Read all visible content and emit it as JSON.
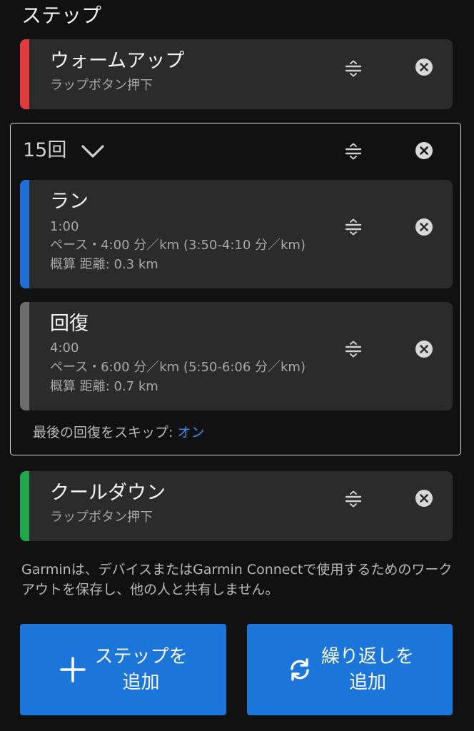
{
  "section_title": "ステップ",
  "colors": {
    "warmup_stripe": "#e03a3a",
    "run_stripe": "#1f6fd6",
    "recovery_stripe": "#6d6d6d",
    "cooldown_stripe": "#1fa54a",
    "accent_link": "#3f8ef0",
    "button_bg": "#1c75d8"
  },
  "warmup": {
    "title": "ウォームアップ",
    "subtitle": "ラップボタン押下",
    "drag_icon": "reorder-icon",
    "remove_icon": "close-circle-icon"
  },
  "repeat": {
    "count_label": "15回",
    "expand_icon": "chevron-down-icon",
    "run": {
      "title": "ラン",
      "duration": "1:00",
      "pace": "ペース・4:00 分／km (3:50-4:10 分／km)",
      "distance": "概算 距離: 0.3 km"
    },
    "recovery": {
      "title": "回復",
      "duration": "4:00",
      "pace": "ペース・6:00 分／km (5:50-6:06 分／km)",
      "distance": "概算 距離: 0.7 km"
    },
    "skip_last_recovery_label": "最後の回復をスキップ: ",
    "skip_last_recovery_value": "オン"
  },
  "cooldown": {
    "title": "クールダウン",
    "subtitle": "ラップボタン押下"
  },
  "notice_text": "Garminは、デバイスまたはGarmin Connectで使用するためのワークアウトを保存し、他の人と共有しません。",
  "buttons": {
    "add_step": "ステップを\n追加",
    "add_repeat": "繰り返しを\n追加",
    "add_step_icon": "plus-icon",
    "add_repeat_icon": "refresh-icon"
  }
}
